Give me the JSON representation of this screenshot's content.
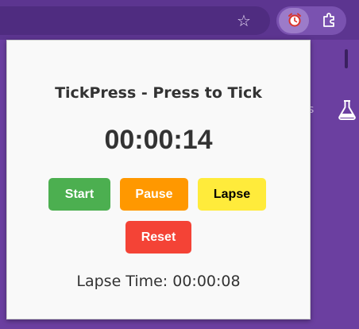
{
  "browser": {
    "bookmark_icon": "star-icon",
    "active_extension_icon": "alarm-clock-icon",
    "extensions_menu_icon": "puzzle-icon",
    "background_icon": "flask-icon",
    "background_text": "s"
  },
  "popup": {
    "title": "TickPress - Press to Tick",
    "elapsed_time": "00:00:14",
    "buttons": {
      "start": "Start",
      "pause": "Pause",
      "lapse": "Lapse",
      "reset": "Reset"
    },
    "lapse_time": "Lapse Time: 00:00:08"
  },
  "colors": {
    "start": "#4caf50",
    "pause": "#ff9800",
    "lapse": "#ffeb3b",
    "reset": "#f44336",
    "browser_frame": "#6b3fa0"
  }
}
